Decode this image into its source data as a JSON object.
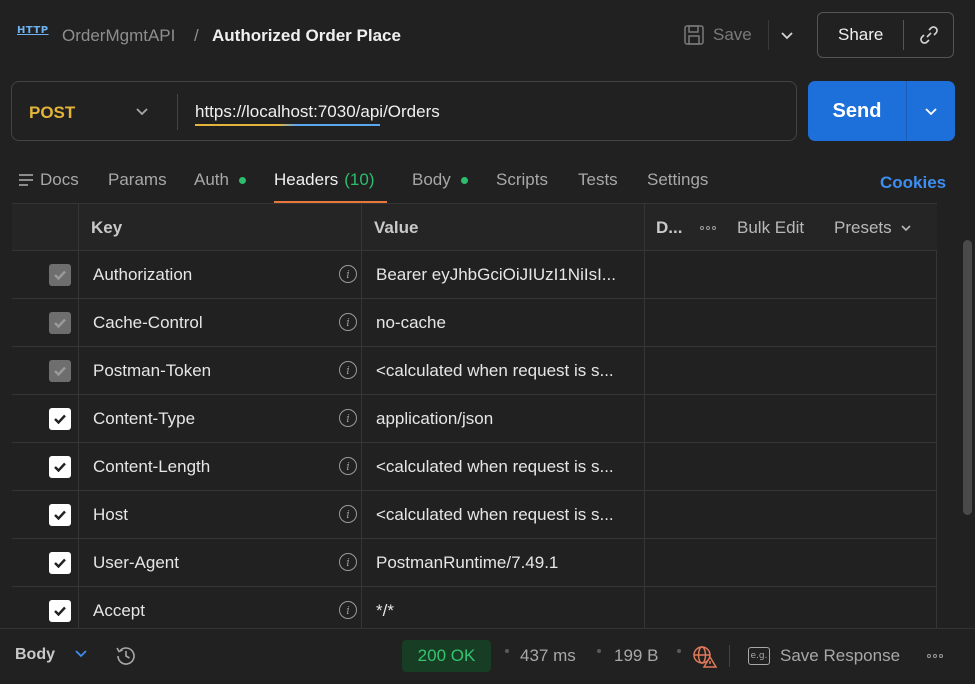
{
  "header": {
    "protocol_badge": "HTTP",
    "collection": "OrderMgmtAPI",
    "separator": "/",
    "request_name": "Authorized Order Place",
    "save_label": "Save",
    "share_label": "Share"
  },
  "request": {
    "method": "POST",
    "url": "https://localhost:7030/api/Orders",
    "send_label": "Send"
  },
  "tabs": [
    {
      "label": "Docs"
    },
    {
      "label": "Params"
    },
    {
      "label": "Auth"
    },
    {
      "label": "Headers",
      "count": "(10)"
    },
    {
      "label": "Body"
    },
    {
      "label": "Scripts"
    },
    {
      "label": "Tests"
    },
    {
      "label": "Settings"
    }
  ],
  "cookies_label": "Cookies",
  "table": {
    "col_key": "Key",
    "col_value": "Value",
    "col_desc": "D...",
    "bulk_edit": "Bulk Edit",
    "presets": "Presets",
    "rows": [
      {
        "key": "Authorization",
        "value": "Bearer eyJhbGciOiJIUzI1NiIsI...",
        "checked": true,
        "locked": true
      },
      {
        "key": "Cache-Control",
        "value": "no-cache",
        "checked": true,
        "locked": true
      },
      {
        "key": "Postman-Token",
        "value": "<calculated when request is s...",
        "checked": true,
        "locked": true
      },
      {
        "key": "Content-Type",
        "value": "application/json",
        "checked": true,
        "locked": false
      },
      {
        "key": "Content-Length",
        "value": "<calculated when request is s...",
        "checked": true,
        "locked": false
      },
      {
        "key": "Host",
        "value": "<calculated when request is s...",
        "checked": true,
        "locked": false
      },
      {
        "key": "User-Agent",
        "value": "PostmanRuntime/7.49.1",
        "checked": true,
        "locked": false
      },
      {
        "key": "Accept",
        "value": "*/*",
        "checked": true,
        "locked": false
      }
    ]
  },
  "footer": {
    "body_label": "Body",
    "status": "200 OK",
    "time": "437 ms",
    "size": "199 B",
    "eg_badge": "e.g.",
    "save_response": "Save Response"
  },
  "colors": {
    "method": "#e4b43a",
    "send": "#1d6fd9",
    "active_tab_underline": "#e8773b",
    "status_ok": "#35c46f",
    "dot_green": "#2dbd6e",
    "link": "#3d8ef0"
  }
}
